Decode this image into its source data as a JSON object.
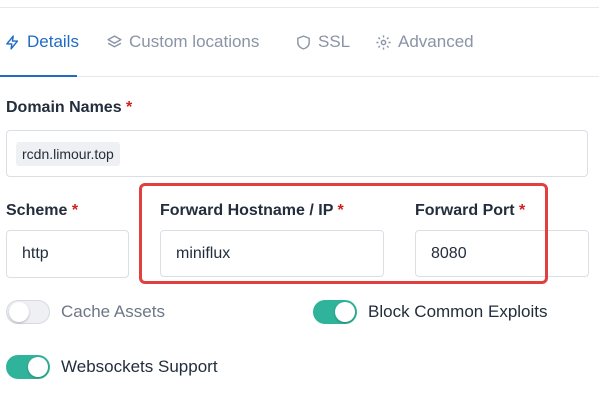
{
  "tabs": [
    {
      "label": "Details",
      "icon": "bolt-icon",
      "active": true
    },
    {
      "label": "Custom locations",
      "icon": "layers-icon",
      "active": false
    },
    {
      "label": "SSL",
      "icon": "shield-icon",
      "active": false
    },
    {
      "label": "Advanced",
      "icon": "gear-icon",
      "active": false
    }
  ],
  "domain": {
    "label": "Domain Names",
    "required": "*",
    "chips": [
      "rcdn.limour.top"
    ]
  },
  "scheme": {
    "label": "Scheme",
    "required": "*",
    "value": "http"
  },
  "forward_host": {
    "label": "Forward Hostname / IP",
    "required": "*",
    "value": "miniflux"
  },
  "forward_port": {
    "label": "Forward Port",
    "required": "*",
    "value": "8080"
  },
  "toggles": {
    "cache_assets": {
      "label": "Cache Assets",
      "on": false
    },
    "block_exploits": {
      "label": "Block Common Exploits",
      "on": true
    },
    "websockets": {
      "label": "Websockets Support",
      "on": true
    }
  },
  "colors": {
    "accent": "#206bc4",
    "toggle_on": "#2fb39a",
    "required": "#cd201f",
    "highlight": "#e0413f"
  }
}
